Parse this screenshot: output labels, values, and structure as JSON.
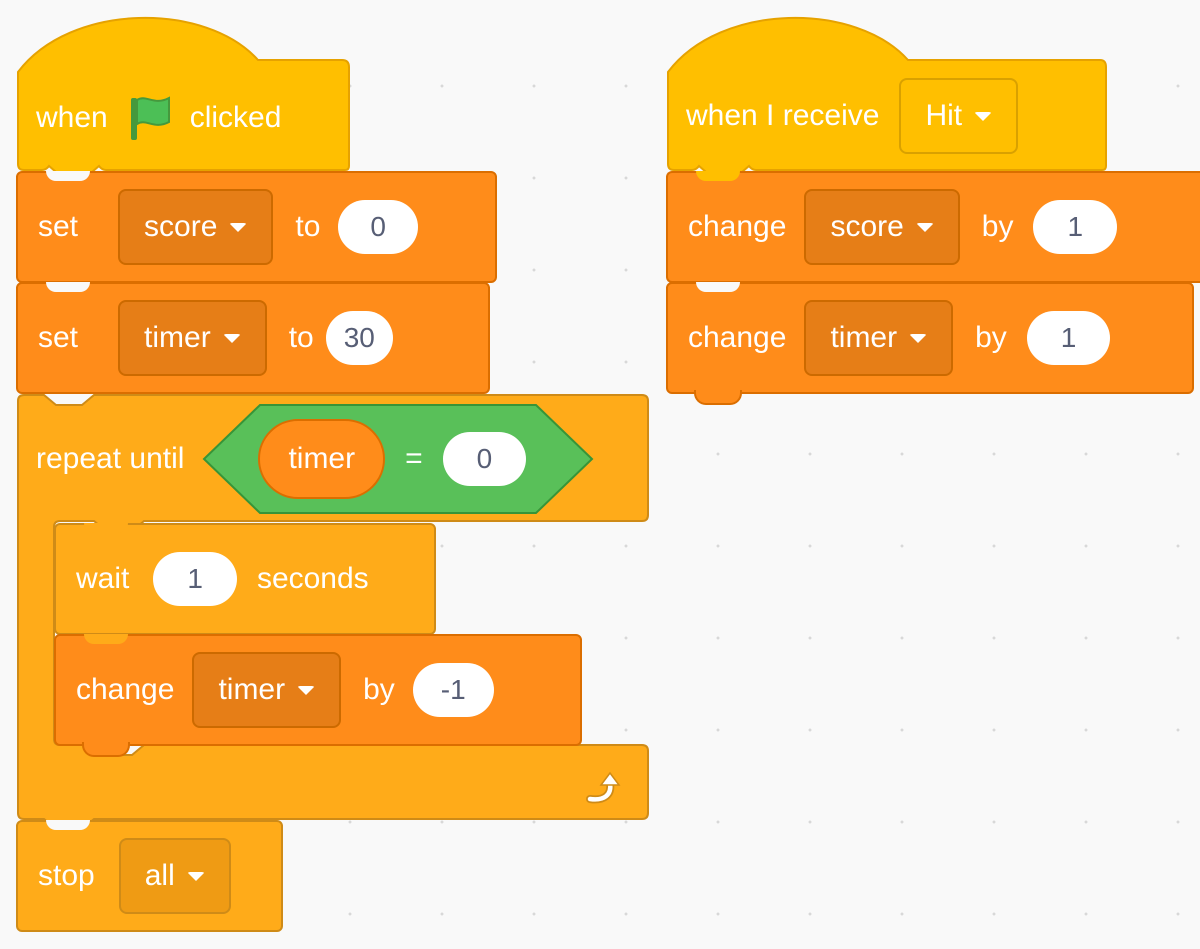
{
  "colors": {
    "events": "#ffbf00",
    "variables": "#ff8c1a",
    "control": "#ffab19",
    "operators": "#59c059",
    "workspace": "#f9f9f9"
  },
  "scripts": [
    {
      "hat": {
        "label_before": "when",
        "icon": "green-flag-icon",
        "label_after": "clicked"
      },
      "set_score": {
        "label": "set",
        "variable": "score",
        "to": "to",
        "value": "0"
      },
      "set_timer": {
        "label": "set",
        "variable": "timer",
        "to": "to",
        "value": "30"
      },
      "repeat": {
        "label": "repeat until",
        "condition": {
          "left": "timer",
          "op": "=",
          "right": "0"
        },
        "wait": {
          "label": "wait",
          "value": "1",
          "unit": "seconds"
        },
        "change": {
          "label": "change",
          "variable": "timer",
          "by": "by",
          "value": "-1"
        },
        "loop_icon": "loop-arrow-icon"
      },
      "stop": {
        "label": "stop",
        "option": "all"
      }
    },
    {
      "hat": {
        "label": "when I receive",
        "message": "Hit"
      },
      "change_score": {
        "label": "change",
        "variable": "score",
        "by": "by",
        "value": "1"
      },
      "change_timer": {
        "label": "change",
        "variable": "timer",
        "by": "by",
        "value": "1"
      }
    }
  ]
}
